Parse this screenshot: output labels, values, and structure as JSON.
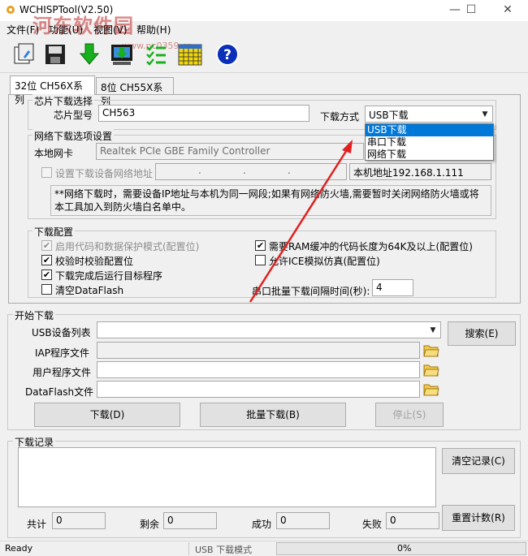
{
  "window": {
    "title": "WCHISPTool(V2.50)",
    "minimize": "—",
    "maximize": "☐",
    "close": "✕"
  },
  "watermark": {
    "text": "河东软件园",
    "url": "www.pc0359.cn"
  },
  "menu": [
    "文件(F)",
    "功能(U)",
    "视图(V)",
    "帮助(H)"
  ],
  "toolbar": {
    "icons": [
      "open-file-icon",
      "save-file-icon",
      "download-icon",
      "download-to-chip-icon",
      "checklist-icon",
      "calendar-grid-icon",
      "help-icon"
    ],
    "help_glyph": "?"
  },
  "tabs": [
    "32位 CH56X系列",
    "8位 CH55X系列"
  ],
  "chip_select": {
    "group_label": "芯片下载选择",
    "model_label": "芯片型号",
    "model_value": "CH563",
    "mode_label": "下载方式",
    "mode_value": "USB下载",
    "mode_options": [
      "USB下载",
      "串口下载",
      "网络下载"
    ]
  },
  "network": {
    "group_label": "网络下载选项设置",
    "nic_label": "本地网卡",
    "nic_value": "Realtek PCIe GBE Family Controller",
    "set_ip_label": "设置下载设备网络地址",
    "ip_dots": ".",
    "local_ip": "本机地址192.168.1.111",
    "note": "**网络下载时，需要设备IP地址与本机为同一网段;如果有网络防火墙,需要暂时关闭网络防火墙或将本工具加入到防火墙白名单中。"
  },
  "config": {
    "group_label": "下载配置",
    "options": [
      {
        "label": "启用代码和数据保护模式(配置位)",
        "checked": true,
        "disabled": true
      },
      {
        "label": "校验时校验配置位",
        "checked": true,
        "disabled": false
      },
      {
        "label": "下载完成后运行目标程序",
        "checked": true,
        "disabled": false
      },
      {
        "label": "清空DataFlash",
        "checked": false,
        "disabled": false
      },
      {
        "label": "需要RAM缓冲的代码长度为64K及以上(配置位)",
        "checked": true,
        "disabled": false
      },
      {
        "label": "允许ICE模拟仿真(配置位)",
        "checked": false,
        "disabled": false
      }
    ],
    "check_glyph": "✔",
    "interval_label": "串口批量下载间隔时间(秒):",
    "interval_value": "4"
  },
  "start": {
    "group_label": "开始下载",
    "usb_list_label": "USB设备列表",
    "iap_label": "IAP程序文件",
    "user_label": "用户程序文件",
    "dataflash_label": "DataFlash文件",
    "search_button": "搜索(E)",
    "download_button": "下载(D)",
    "batch_button": "批量下载(B)",
    "stop_button": "停止(S)"
  },
  "log": {
    "group_label": "下载记录",
    "clear_button": "清空记录(C)",
    "reset_button": "重置计数(R)",
    "total_label": "共计",
    "total_value": "0",
    "remain_label": "剩余",
    "remain_value": "0",
    "success_label": "成功",
    "success_value": "0",
    "fail_label": "失败",
    "fail_value": "0"
  },
  "status": {
    "left": "Ready",
    "mode": "USB 下载模式",
    "progress": "0%"
  },
  "colors": {
    "arrow": "#e02020",
    "selection": "#0078d7",
    "help_icon": "#0a2fb8"
  }
}
